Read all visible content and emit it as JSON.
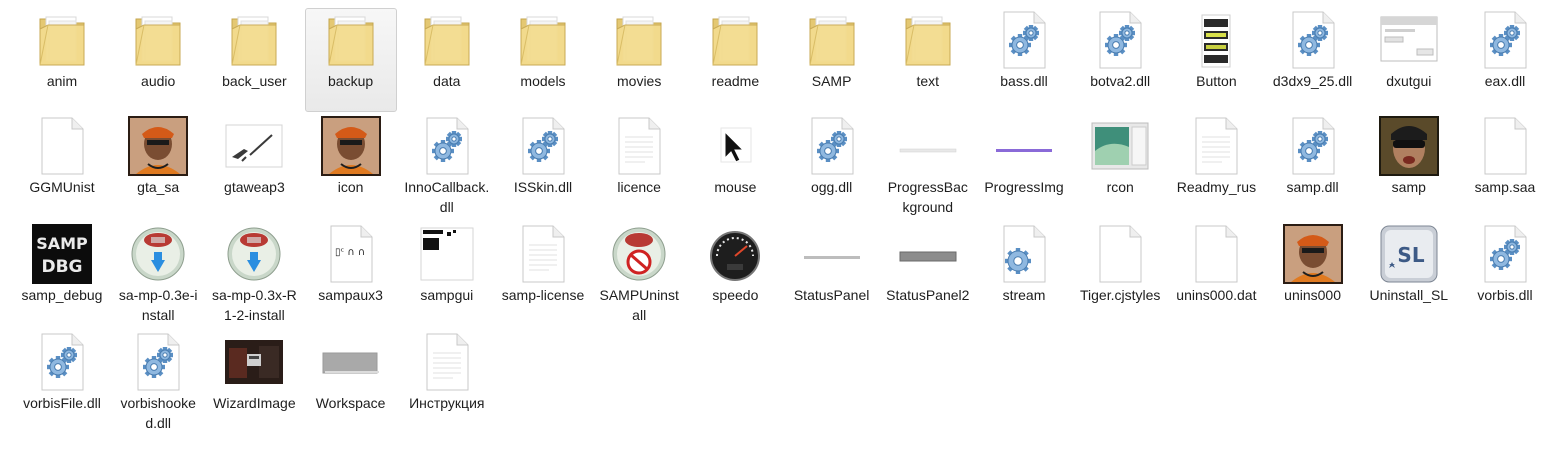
{
  "selected_item": "backup",
  "items": [
    {
      "label": "anim",
      "icon": "folder-icon"
    },
    {
      "label": "audio",
      "icon": "folder-icon"
    },
    {
      "label": "back_user",
      "icon": "folder-icon"
    },
    {
      "label": "backup",
      "icon": "folder-icon"
    },
    {
      "label": "data",
      "icon": "folder-icon"
    },
    {
      "label": "models",
      "icon": "folder-icon"
    },
    {
      "label": "movies",
      "icon": "folder-icon"
    },
    {
      "label": "readme",
      "icon": "folder-icon"
    },
    {
      "label": "SAMP",
      "icon": "folder-icon"
    },
    {
      "label": "text",
      "icon": "folder-icon"
    },
    {
      "label": "bass.dll",
      "icon": "dll-file-icon"
    },
    {
      "label": "botva2.dll",
      "icon": "dll-file-icon"
    },
    {
      "label": "Button",
      "icon": "button-image-icon"
    },
    {
      "label": "d3dx9_25.dll",
      "icon": "dll-file-icon"
    },
    {
      "label": "dxutgui",
      "icon": "dialog-image-icon"
    },
    {
      "label": "eax.dll",
      "icon": "dll-file-icon"
    },
    {
      "label": "GGMUnist",
      "icon": "blank-file-icon"
    },
    {
      "label": "gta_sa",
      "icon": "cj-portrait-icon"
    },
    {
      "label": "gtaweap3",
      "icon": "weapon-image-icon"
    },
    {
      "label": "icon",
      "icon": "cj-portrait-icon"
    },
    {
      "label": "InnoCallback.dll",
      "icon": "dll-file-icon"
    },
    {
      "label": "ISSkin.dll",
      "icon": "dll-file-icon"
    },
    {
      "label": "licence",
      "icon": "text-file-icon"
    },
    {
      "label": "mouse",
      "icon": "cursor-icon"
    },
    {
      "label": "ogg.dll",
      "icon": "dll-file-icon"
    },
    {
      "label": "ProgressBackground",
      "icon": "progress-background-icon"
    },
    {
      "label": "ProgressImg",
      "icon": "progress-image-icon"
    },
    {
      "label": "rcon",
      "icon": "window-image-icon"
    },
    {
      "label": "Readmy_rus",
      "icon": "text-file-icon"
    },
    {
      "label": "samp.dll",
      "icon": "dll-file-icon"
    },
    {
      "label": "samp",
      "icon": "samp-portrait-icon"
    },
    {
      "label": "samp.saa",
      "icon": "blank-file-icon"
    },
    {
      "label": "samp_debug",
      "icon": "samp-dbg-icon"
    },
    {
      "label": "sa-mp-0.3e-install",
      "icon": "installer-globe-icon"
    },
    {
      "label": "sa-mp-0.3x-R1-2-install",
      "icon": "installer-globe-icon"
    },
    {
      "label": "sampaux3",
      "icon": "sampaux-image-icon"
    },
    {
      "label": "sampgui",
      "icon": "sampgui-image-icon"
    },
    {
      "label": "samp-license",
      "icon": "text-file-icon"
    },
    {
      "label": "SAMPUninstall",
      "icon": "uninstall-globe-icon"
    },
    {
      "label": "speedo",
      "icon": "speedometer-icon"
    },
    {
      "label": "StatusPanel",
      "icon": "status-panel-icon"
    },
    {
      "label": "StatusPanel2",
      "icon": "status-panel2-icon"
    },
    {
      "label": "stream",
      "icon": "gear-file-icon"
    },
    {
      "label": "Tiger.cjstyles",
      "icon": "blank-file-icon"
    },
    {
      "label": "unins000.dat",
      "icon": "blank-file-icon"
    },
    {
      "label": "unins000",
      "icon": "cj-portrait-icon"
    },
    {
      "label": "Uninstall_SL",
      "icon": "sl-logo-icon"
    },
    {
      "label": "vorbis.dll",
      "icon": "dll-file-icon"
    },
    {
      "label": "vorbisFile.dll",
      "icon": "dll-file-icon"
    },
    {
      "label": "vorbishooked.dll",
      "icon": "dll-file-icon"
    },
    {
      "label": "WizardImage",
      "icon": "wizard-image-icon"
    },
    {
      "label": "Workspace",
      "icon": "workspace-image-icon"
    },
    {
      "label": "Инструкция",
      "icon": "text-file-icon"
    }
  ]
}
